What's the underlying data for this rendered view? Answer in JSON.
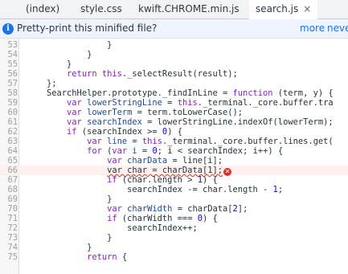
{
  "tabs": [
    {
      "label": "(index)",
      "active": false
    },
    {
      "label": "style.css",
      "active": false
    },
    {
      "label": "kwift.CHROME.min.js",
      "active": false
    },
    {
      "label": "search.js",
      "active": true,
      "close": "×"
    }
  ],
  "infobar": {
    "icon": "i",
    "message": "Pretty-print this minified file?",
    "more_label": "more",
    "never_label": "neve"
  },
  "colors": {
    "keyword": "#8b1dcc",
    "property": "#224b8d",
    "number": "#1c00cf",
    "error": "#d93025",
    "link": "#1a73e8"
  },
  "code_lines": [
    {
      "n": "53",
      "tokens": [
        {
          "t": "                }",
          "c": "plain"
        }
      ]
    },
    {
      "n": "54",
      "tokens": [
        {
          "t": "            }",
          "c": "plain"
        }
      ]
    },
    {
      "n": "55",
      "tokens": [
        {
          "t": "        }",
          "c": "plain"
        }
      ]
    },
    {
      "n": "56",
      "tokens": [
        {
          "t": "        ",
          "c": "plain"
        },
        {
          "t": "return",
          "c": "kw"
        },
        {
          "t": " ",
          "c": "plain"
        },
        {
          "t": "this",
          "c": "kw"
        },
        {
          "t": "._selectResult(result);",
          "c": "plain"
        }
      ]
    },
    {
      "n": "57",
      "tokens": [
        {
          "t": "    };",
          "c": "plain"
        }
      ]
    },
    {
      "n": "58",
      "tokens": [
        {
          "t": "    SearchHelper.prototype._findInLine = ",
          "c": "plain"
        },
        {
          "t": "function",
          "c": "kw"
        },
        {
          "t": " (term, y) {",
          "c": "plain"
        }
      ]
    },
    {
      "n": "59",
      "tokens": [
        {
          "t": "        ",
          "c": "plain"
        },
        {
          "t": "var",
          "c": "kw"
        },
        {
          "t": " lowerStringLine",
          "c": "prop"
        },
        {
          "t": " = ",
          "c": "plain"
        },
        {
          "t": "this",
          "c": "kw"
        },
        {
          "t": "._terminal._core.buffer.tra",
          "c": "plain"
        }
      ]
    },
    {
      "n": "60",
      "tokens": [
        {
          "t": "        ",
          "c": "plain"
        },
        {
          "t": "var",
          "c": "kw"
        },
        {
          "t": " lowerTerm",
          "c": "prop"
        },
        {
          "t": " = term.toLowerCase();",
          "c": "plain"
        }
      ]
    },
    {
      "n": "61",
      "tokens": [
        {
          "t": "        ",
          "c": "plain"
        },
        {
          "t": "var",
          "c": "kw"
        },
        {
          "t": " searchIndex",
          "c": "prop"
        },
        {
          "t": " = lowerStringLine.indexOf(lowerTerm);",
          "c": "plain"
        }
      ]
    },
    {
      "n": "62",
      "tokens": [
        {
          "t": "        ",
          "c": "plain"
        },
        {
          "t": "if",
          "c": "kw"
        },
        {
          "t": " (searchIndex >= ",
          "c": "plain"
        },
        {
          "t": "0",
          "c": "num"
        },
        {
          "t": ") {",
          "c": "plain"
        }
      ]
    },
    {
      "n": "63",
      "tokens": [
        {
          "t": "            ",
          "c": "plain"
        },
        {
          "t": "var",
          "c": "kw"
        },
        {
          "t": " line",
          "c": "prop"
        },
        {
          "t": " = ",
          "c": "plain"
        },
        {
          "t": "this",
          "c": "kw"
        },
        {
          "t": "._terminal._core.buffer.lines.get(",
          "c": "plain"
        }
      ]
    },
    {
      "n": "64",
      "tokens": [
        {
          "t": "            ",
          "c": "plain"
        },
        {
          "t": "for",
          "c": "kw"
        },
        {
          "t": " (",
          "c": "plain"
        },
        {
          "t": "var",
          "c": "kw"
        },
        {
          "t": " i",
          "c": "prop"
        },
        {
          "t": " = ",
          "c": "plain"
        },
        {
          "t": "0",
          "c": "num"
        },
        {
          "t": "; i < searchIndex; i++) {",
          "c": "plain"
        }
      ]
    },
    {
      "n": "65",
      "tokens": [
        {
          "t": "                ",
          "c": "plain"
        },
        {
          "t": "var",
          "c": "kw"
        },
        {
          "t": " charData",
          "c": "prop"
        },
        {
          "t": " = line[i];",
          "c": "plain"
        }
      ]
    },
    {
      "n": "66",
      "error": true,
      "tokens": [
        {
          "t": "                ",
          "c": "plain"
        },
        {
          "t": "var char = charData[1];",
          "c": "squiggle"
        }
      ]
    },
    {
      "n": "67",
      "tokens": [
        {
          "t": "                ",
          "c": "plain"
        },
        {
          "t": "if",
          "c": "kw"
        },
        {
          "t": " (char.length > ",
          "c": "plain"
        },
        {
          "t": "1",
          "c": "num"
        },
        {
          "t": ") {",
          "c": "plain"
        }
      ]
    },
    {
      "n": "68",
      "tokens": [
        {
          "t": "                    searchIndex -= char.length - ",
          "c": "plain"
        },
        {
          "t": "1",
          "c": "num"
        },
        {
          "t": ";",
          "c": "plain"
        }
      ]
    },
    {
      "n": "69",
      "tokens": [
        {
          "t": "                }",
          "c": "plain"
        }
      ]
    },
    {
      "n": "70",
      "tokens": [
        {
          "t": "                ",
          "c": "plain"
        },
        {
          "t": "var",
          "c": "kw"
        },
        {
          "t": " charWidth",
          "c": "prop"
        },
        {
          "t": " = charData[",
          "c": "plain"
        },
        {
          "t": "2",
          "c": "num"
        },
        {
          "t": "];",
          "c": "plain"
        }
      ]
    },
    {
      "n": "71",
      "tokens": [
        {
          "t": "                ",
          "c": "plain"
        },
        {
          "t": "if",
          "c": "kw"
        },
        {
          "t": " (charWidth === ",
          "c": "plain"
        },
        {
          "t": "0",
          "c": "num"
        },
        {
          "t": ") {",
          "c": "plain"
        }
      ]
    },
    {
      "n": "72",
      "tokens": [
        {
          "t": "                    searchIndex++;",
          "c": "plain"
        }
      ]
    },
    {
      "n": "73",
      "tokens": [
        {
          "t": "                }",
          "c": "plain"
        }
      ]
    },
    {
      "n": "74",
      "tokens": [
        {
          "t": "            }",
          "c": "plain"
        }
      ]
    },
    {
      "n": "75",
      "tokens": [
        {
          "t": "            ",
          "c": "plain"
        },
        {
          "t": "return",
          "c": "kw"
        },
        {
          "t": " {",
          "c": "plain"
        }
      ]
    }
  ]
}
